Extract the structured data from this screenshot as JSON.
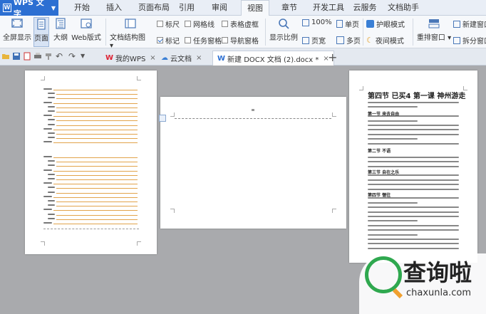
{
  "app": {
    "name": "WPS 文字"
  },
  "menu_tabs": [
    {
      "label": "开始"
    },
    {
      "label": "插入"
    },
    {
      "label": "页面布局"
    },
    {
      "label": "引用"
    },
    {
      "label": "审阅"
    },
    {
      "label": "视图"
    },
    {
      "label": "章节"
    },
    {
      "label": "开发工具"
    },
    {
      "label": "云服务"
    },
    {
      "label": "文档助手"
    }
  ],
  "ribbon": {
    "fullscreen": "全屏显示",
    "page": "页面",
    "outline": "大纲",
    "web": "Web版式",
    "doc_map": "文档结构图",
    "ruler": "标尺",
    "grid": "网格线",
    "table_border": "表格虚框",
    "marks": "标记",
    "task_pane": "任务窗格",
    "nav_pane": "导航窗格",
    "zoom": "显示比例",
    "zoom_100": "100%",
    "page_width": "页宽",
    "single_page": "单页",
    "multi_page": "多页",
    "eye_mode": "护眼模式",
    "night_mode": "夜间模式",
    "rearrange": "重排窗口",
    "new_window": "新建窗口",
    "split_window": "拆分窗口"
  },
  "doc_tabs": [
    {
      "label": "我的WPS"
    },
    {
      "label": "云文档"
    },
    {
      "label": "新建 DOCX 文档 (2).docx *"
    }
  ],
  "page3": {
    "title": "第四节 已买4 第一课   神州游走",
    "sections": [
      "第一节 来去自由",
      "第二节 不语",
      "第三节 自在之乐",
      "第四节 惬往"
    ]
  },
  "watermark": {
    "text": "查询啦",
    "url": "chaxunla.com"
  }
}
